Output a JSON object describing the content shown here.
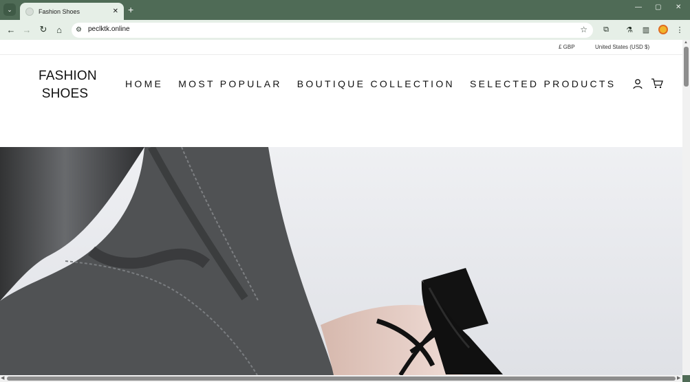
{
  "browser": {
    "tab_title": "Fashion Shoes",
    "url": "peclktk.online",
    "new_tab_label": "+",
    "close_label": "✕",
    "minimize_label": "—",
    "maximize_label": "▢",
    "window_close_label": "✕",
    "accent_color": "#4f6b56"
  },
  "icons": {
    "tab_search": "chevron-down-icon",
    "back": "back-arrow-icon",
    "forward": "forward-arrow-icon",
    "reload": "reload-icon",
    "home": "home-icon",
    "site_info": "tune-icon",
    "bookmark": "star-icon",
    "extensions": "puzzle-icon",
    "labs": "flask-icon",
    "sidebar": "sidebar-icon",
    "menu": "more-vertical-icon",
    "account": "account-icon",
    "cart": "cart-icon"
  },
  "store": {
    "currency": "£ GBP",
    "country_currency": "United States (USD $)",
    "logo_line1": "FASHION",
    "logo_line2": "SHOES",
    "nav": [
      "HOME",
      "MOST POPULAR",
      "BOUTIQUE COLLECTION",
      "SELECTED PRODUCTS"
    ]
  }
}
